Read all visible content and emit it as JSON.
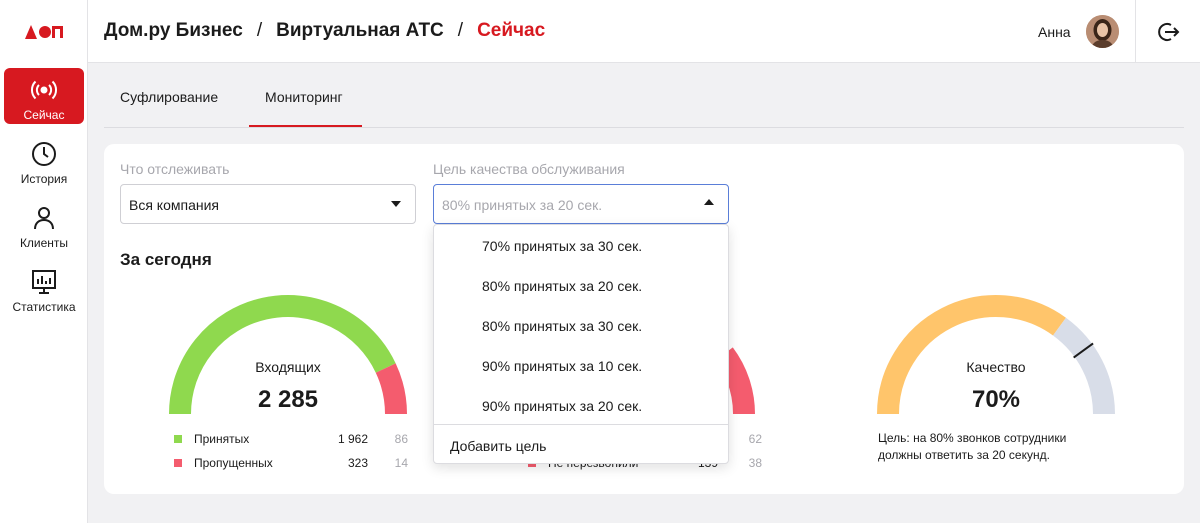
{
  "app": {
    "logo": "ДОМ"
  },
  "sidebar": {
    "items": [
      {
        "label": "Сейчас",
        "icon": "broadcast-icon",
        "active": true
      },
      {
        "label": "История",
        "icon": "clock-icon"
      },
      {
        "label": "Клиенты",
        "icon": "person-icon"
      },
      {
        "label": "Статистика",
        "icon": "chart-monitor-icon"
      }
    ]
  },
  "header": {
    "crumbs": [
      "Дом.ру Бизнес",
      "Виртуальная АТС",
      "Сейчас"
    ],
    "separator": "/",
    "user_name": "Анна"
  },
  "tabs": [
    {
      "label": "Суфлирование"
    },
    {
      "label": "Мониторинг",
      "active": true
    }
  ],
  "filters": {
    "track_label": "Что отслеживать",
    "track_value": "Вся компания",
    "goal_label": "Цель качества обслуживания",
    "goal_placeholder": "80% принятых за 20 сек."
  },
  "section_title": "За сегодня",
  "incoming": {
    "label": "Входящих",
    "value": "2 285",
    "accepted_fraction": 0.86,
    "legend": [
      {
        "name": "Принятых",
        "value": "1 962",
        "percent": "86",
        "color": "#8fd94e"
      },
      {
        "name": "Пропущенных",
        "value": "323",
        "percent": "14",
        "color": "#f45c6e"
      }
    ]
  },
  "middle": {
    "legend": [
      {
        "name": "",
        "value": "",
        "percent": "62"
      },
      {
        "name": "Не перезвонили",
        "value": "139",
        "percent": "38"
      }
    ]
  },
  "quality": {
    "label": "Качество",
    "value": "70%",
    "fraction": 0.7,
    "target_fraction": 0.8,
    "note_line1": "Цель: на 80% звонков сотрудники",
    "note_line2": "должны ответить за 20 секунд.",
    "colors": {
      "filled": "#ffc56b",
      "rest": "#d8dde8"
    }
  },
  "dropdown": {
    "options": [
      "70% принятых за 30 сек.",
      "80% принятых за 20 сек.",
      "80% принятых за 30 сек.",
      "90% принятых за 10 сек.",
      "90% принятых за 20 сек."
    ],
    "add_label": "Добавить цель"
  },
  "colors": {
    "accent": "#d71920",
    "green": "#8fd94e",
    "red": "#f45c6e",
    "focus": "#5a7ed8"
  }
}
